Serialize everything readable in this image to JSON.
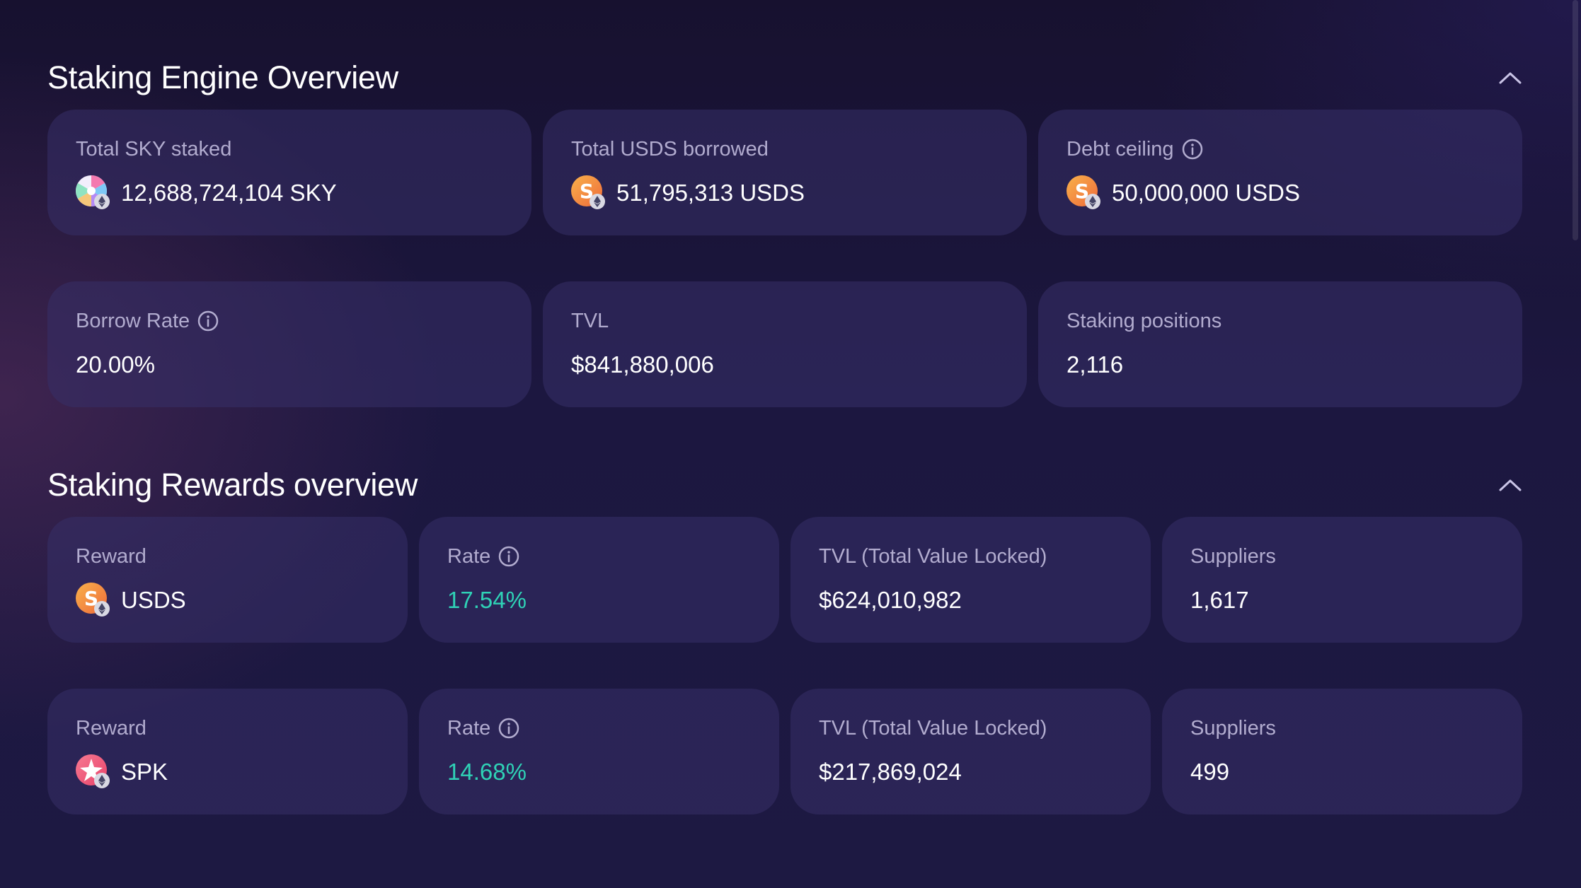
{
  "engine_overview": {
    "title": "Staking Engine Overview",
    "cards": [
      {
        "label": "Total SKY staked",
        "value": "12,688,724,104 SKY",
        "icon": "sky-token-icon"
      },
      {
        "label": "Total USDS borrowed",
        "value": "51,795,313 USDS",
        "icon": "usds-token-icon"
      },
      {
        "label": "Debt ceiling",
        "value": "50,000,000 USDS",
        "icon": "usds-token-icon",
        "info": true
      },
      {
        "label": "Borrow Rate",
        "value": "20.00%",
        "info": true
      },
      {
        "label": "TVL",
        "value": "$841,880,006"
      },
      {
        "label": "Staking positions",
        "value": "2,116"
      }
    ]
  },
  "rewards_overview": {
    "title": "Staking Rewards overview",
    "rows": [
      {
        "reward_label": "Reward",
        "reward_value": "USDS",
        "reward_icon": "usds-token-icon",
        "rate_label": "Rate",
        "rate_value": "17.54%",
        "tvl_label": "TVL (Total Value Locked)",
        "tvl_value": "$624,010,982",
        "suppliers_label": "Suppliers",
        "suppliers_value": "1,617"
      },
      {
        "reward_label": "Reward",
        "reward_value": "SPK",
        "reward_icon": "spk-token-icon",
        "rate_label": "Rate",
        "rate_value": "14.68%",
        "tvl_label": "TVL (Total Value Locked)",
        "tvl_value": "$217,869,024",
        "suppliers_label": "Suppliers",
        "suppliers_value": "499"
      }
    ]
  },
  "colors": {
    "background": "#1c1740",
    "card": "#2e2860",
    "label": "#b2accf",
    "rate_accent": "#2fd2b6",
    "usds_orange": "#f08a3c",
    "spk_pink": "#f2557e"
  }
}
